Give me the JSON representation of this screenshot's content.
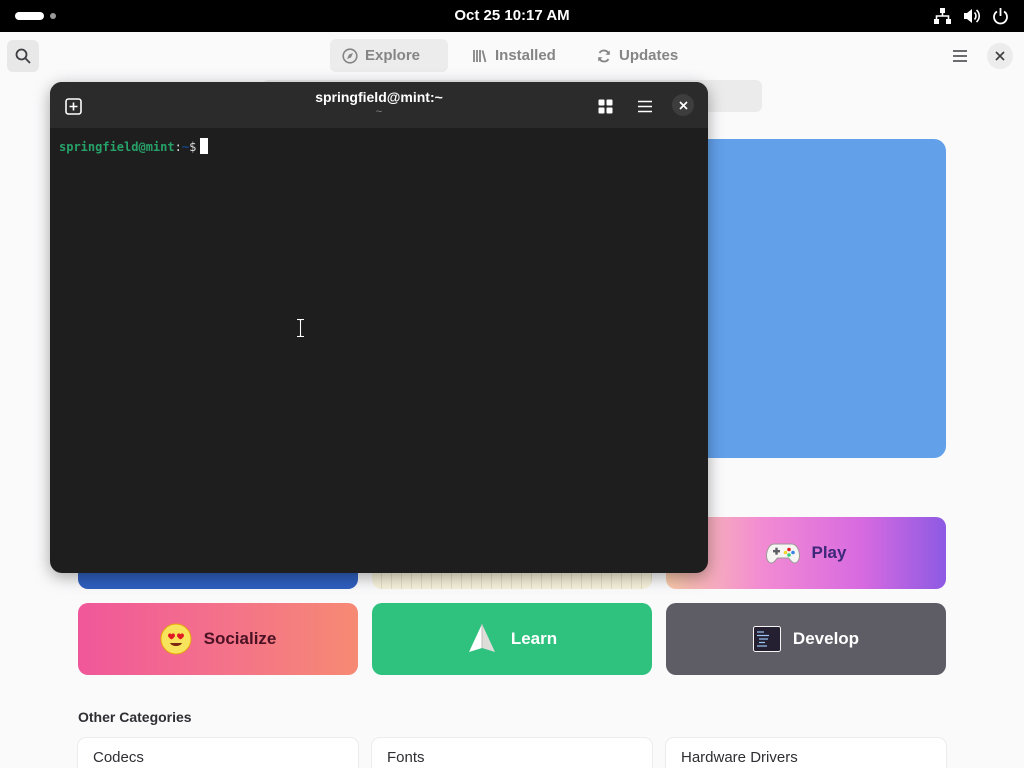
{
  "topbar": {
    "clock": "Oct 25  10:17 AM",
    "tray_icons": [
      "network-icon",
      "volume-icon",
      "power-icon"
    ]
  },
  "software": {
    "tabs": [
      {
        "label": "Explore",
        "icon": "compass-icon"
      },
      {
        "label": "Installed",
        "icon": "library-icon"
      },
      {
        "label": "Updates",
        "icon": "refresh-icon"
      }
    ],
    "categories": {
      "play": "Play",
      "socialize": "Socialize",
      "learn": "Learn",
      "develop": "Develop"
    },
    "other_title": "Other Categories",
    "other_categories": [
      "Codecs",
      "Fonts",
      "Hardware Drivers"
    ],
    "colors": {
      "featured": "#62a0ea",
      "learn": "#2ec27e",
      "develop": "#5e5c64"
    }
  },
  "terminal": {
    "title": "springfield@mint:~",
    "subtitle": "~",
    "prompt": {
      "user_host": "springfield@mint",
      "separator": ":",
      "path": "~",
      "symbol": "$"
    },
    "colors": {
      "background": "#1e1e1e",
      "prompt_user": "#26a269"
    }
  }
}
